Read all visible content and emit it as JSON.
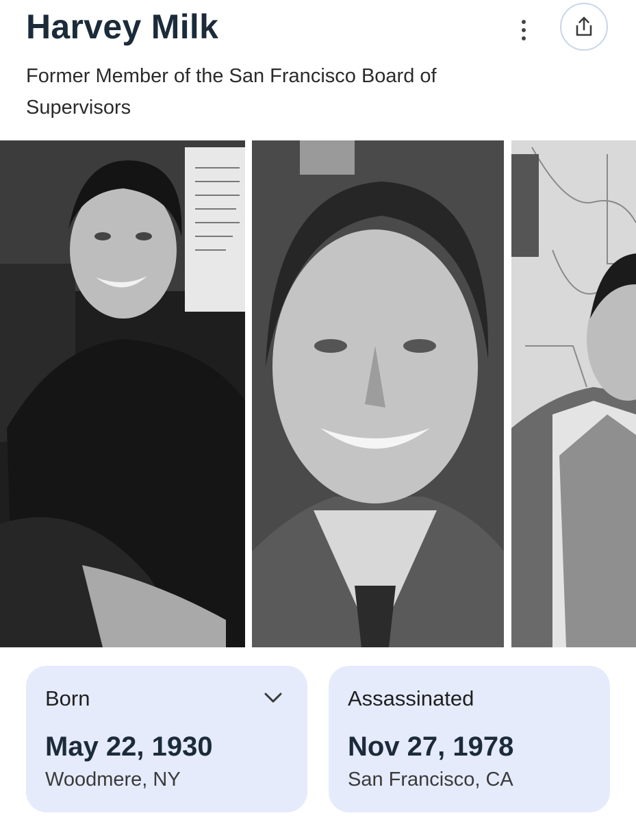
{
  "header": {
    "title": "Harvey Milk",
    "subtitle": "Former Member of the San Francisco Board of Supervisors"
  },
  "actions": {
    "more_icon": "more-vert-icon",
    "share_icon": "share-icon",
    "accent_color": "#1a73e8"
  },
  "images": [
    {
      "description": "Black and white photo of Harvey Milk smiling, seated, wearing a dark vest and shirt"
    },
    {
      "description": "Black and white close-up portrait of Harvey Milk smiling, striped shirt and tie"
    },
    {
      "description": "Black and white photo of Harvey Milk in a suit and striped tie in front of a map"
    }
  ],
  "facts": {
    "born": {
      "label": "Born",
      "date": "May 22, 1930",
      "place": "Woodmere, NY",
      "icon": "chevron-down-icon"
    },
    "assassinated": {
      "label": "Assassinated",
      "date": "Nov 27, 1978",
      "place": "San Francisco, CA"
    }
  },
  "colors": {
    "card_background": "#e5ebfb",
    "title_color": "#1c2b3a"
  }
}
